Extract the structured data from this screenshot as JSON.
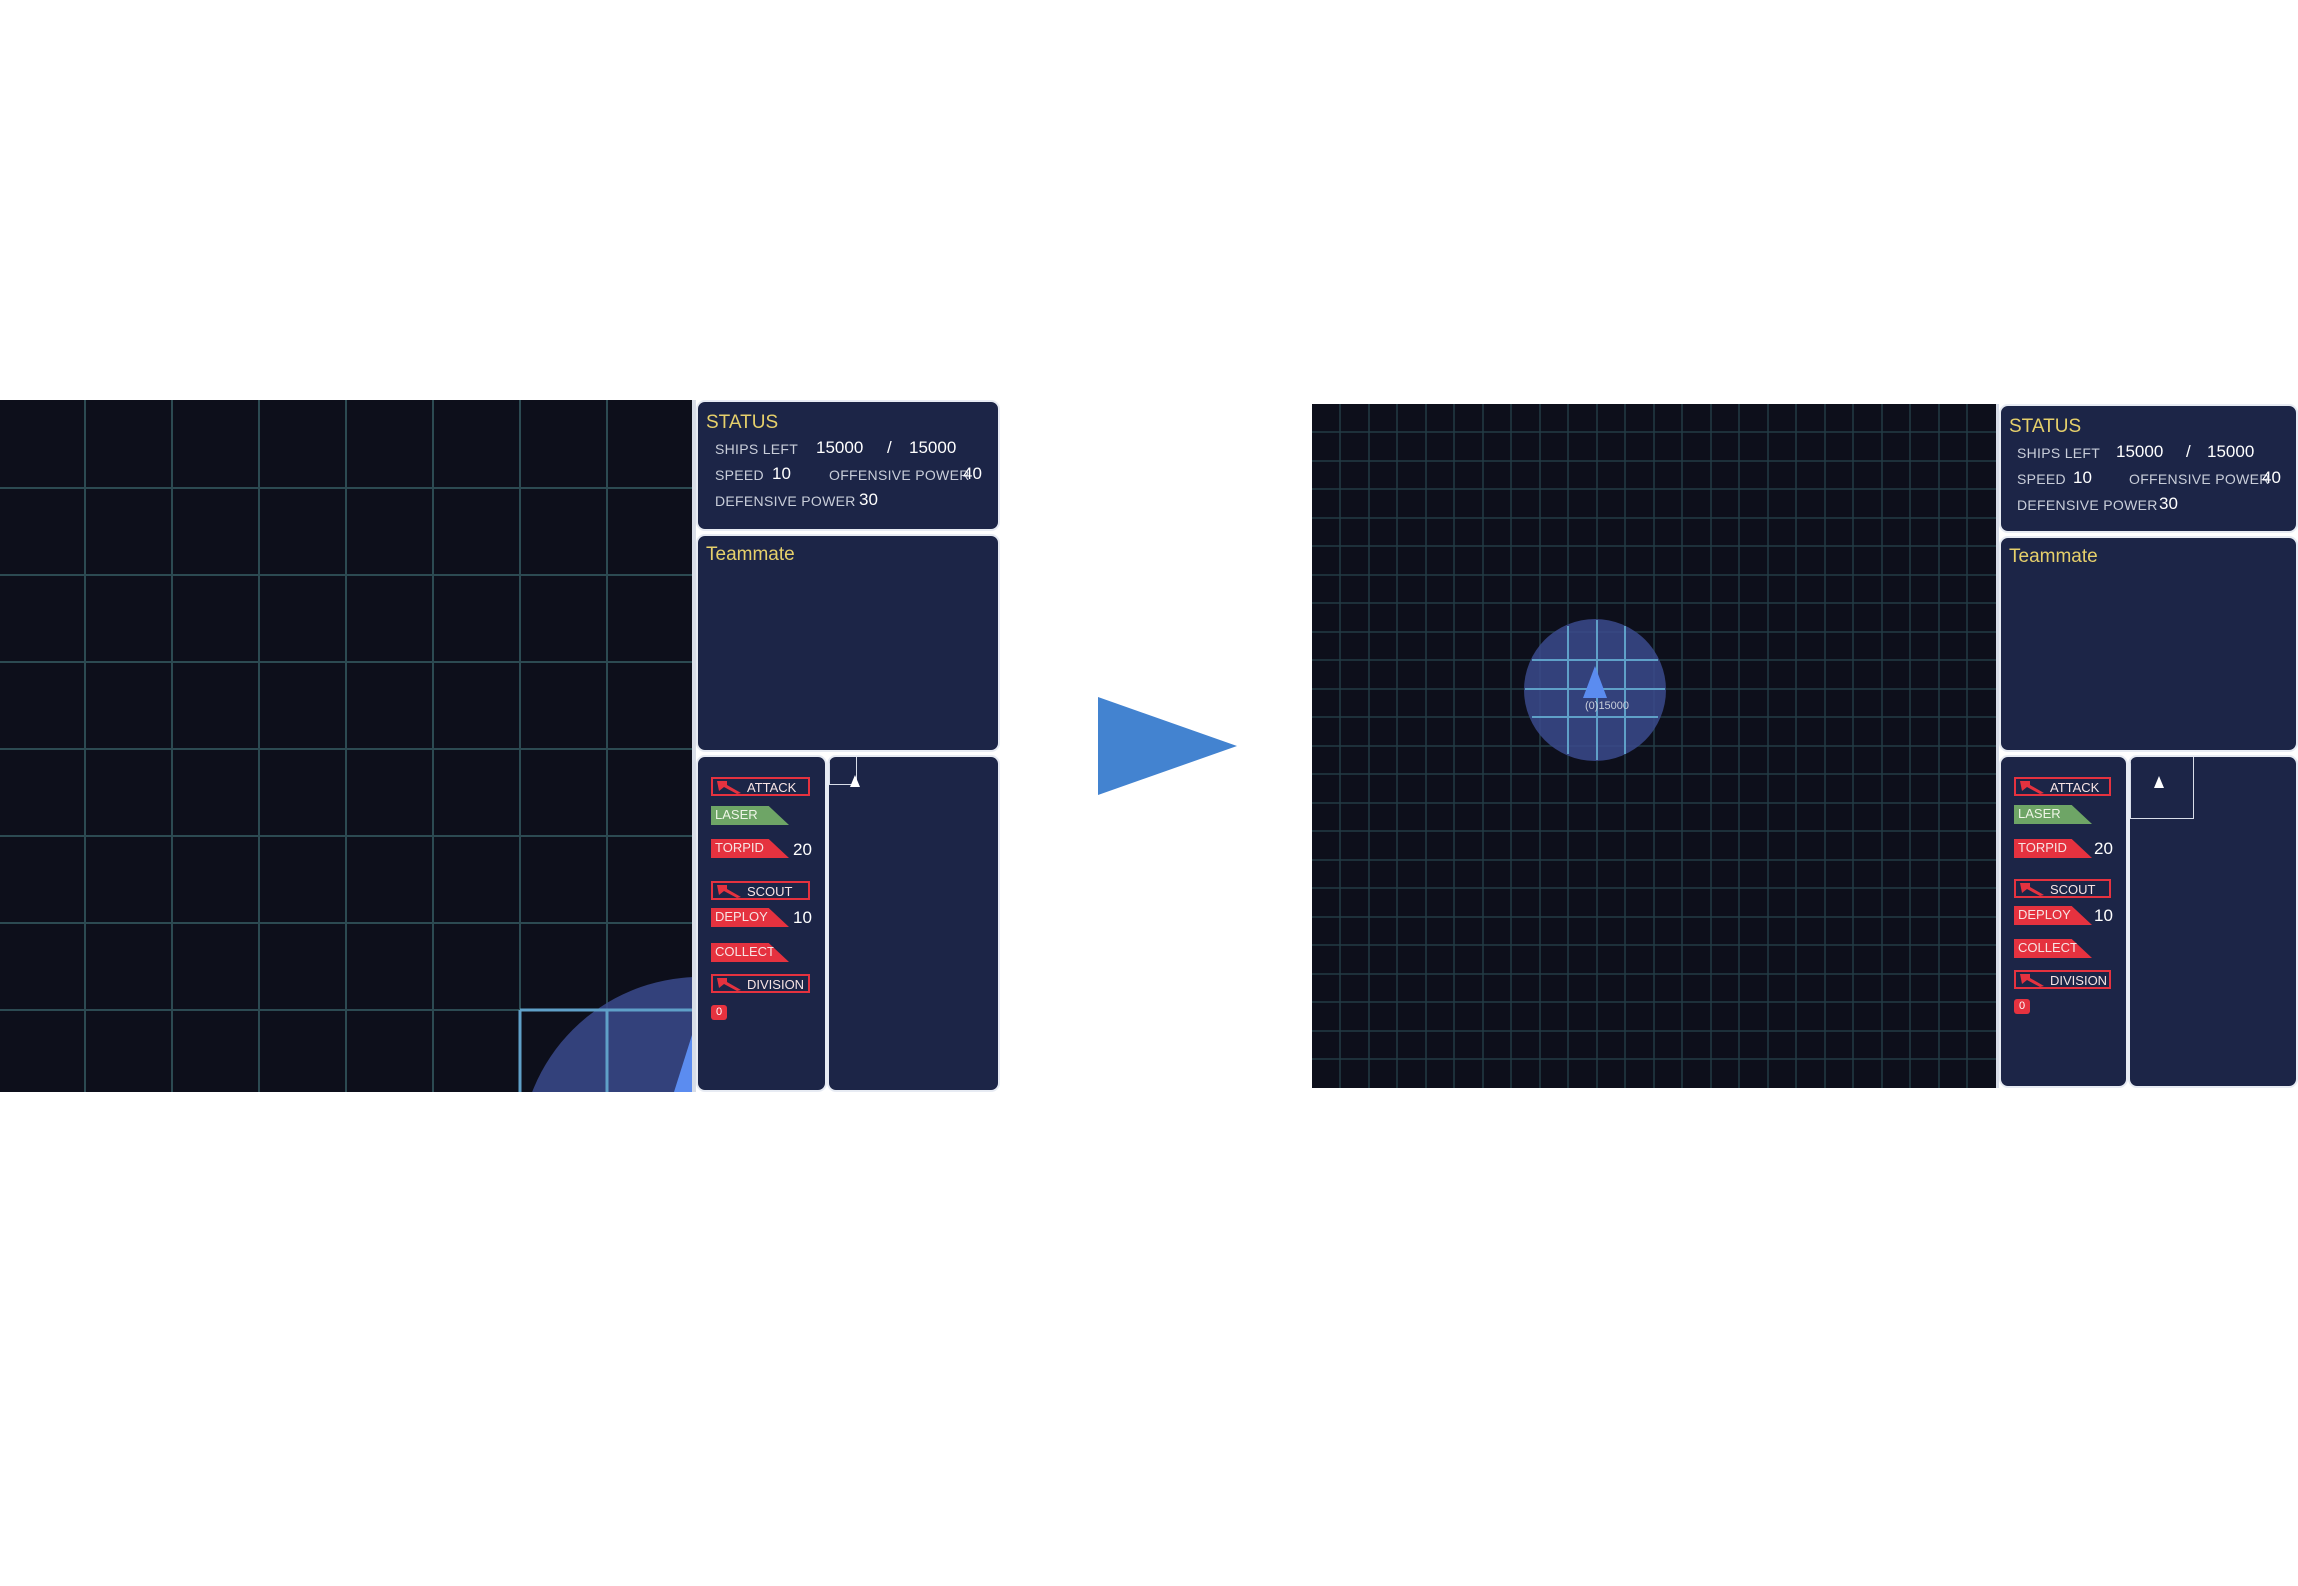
{
  "status": {
    "title": "STATUS",
    "ships_left_label": "SHIPS LEFT",
    "ships_left": "15000",
    "ships_sep": "/",
    "ships_max": "15000",
    "speed_label": "SPEED",
    "speed": "10",
    "offensive_label": "OFFENSIVE POWER",
    "offensive": "40",
    "defensive_label": "DEFENSIVE POWER",
    "defensive": "30"
  },
  "teammate": {
    "title": "Teammate"
  },
  "commands": {
    "attack": "ATTACK",
    "laser": "LASER",
    "torpid": "TORPID",
    "torpid_count": "20",
    "scout": "SCOUT",
    "deploy": "DEPLOY",
    "deploy_count": "10",
    "collect": "COLLECT",
    "division": "DIVISION",
    "division_badge": "0"
  },
  "map": {
    "unit_label": "(0)15000"
  },
  "icons": [
    "attack-icon",
    "scout-icon",
    "division-icon",
    "ship-arrow-icon",
    "transition-arrow-icon"
  ],
  "colors": {
    "map_bg": "#0d0f1b",
    "grid": "#2c4a52",
    "panel_bg": "#1c2547",
    "accent_red": "#e5323f",
    "accent_green": "#6ea566",
    "title_yellow": "#e6d06b",
    "range_circle": "#3b4a8c",
    "ship_blue": "#5b8cf0",
    "arrow_blue": "#4383d0"
  }
}
